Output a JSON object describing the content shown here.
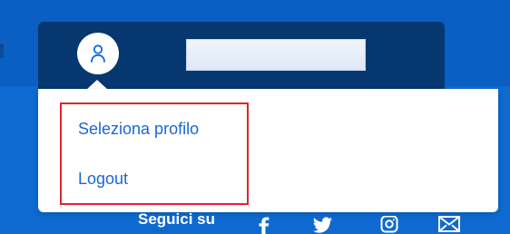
{
  "header": {
    "avatar_icon": "user-icon"
  },
  "menu": {
    "items": [
      {
        "label": "Seleziona profilo"
      },
      {
        "label": "Logout"
      }
    ]
  },
  "footer": {
    "follow_label": "Seguici su",
    "social_icons": [
      "facebook-icon",
      "twitter-icon",
      "instagram-icon",
      "email-icon"
    ]
  },
  "colors": {
    "brand_blue": "#0b5ec2",
    "dark_blue": "#06386f",
    "link_blue": "#1967d2",
    "highlight_red": "#e0242b"
  }
}
